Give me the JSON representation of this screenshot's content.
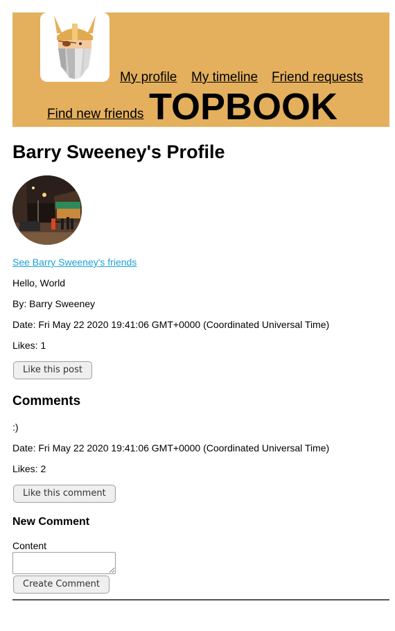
{
  "header": {
    "nav": {
      "my_profile": "My profile",
      "my_timeline": "My timeline",
      "friend_requests": "Friend requests",
      "find_new_friends": "Find new friends"
    },
    "brand": "TOPBOOK",
    "logo_icon": "viking-helmet-logo-icon",
    "background_color": "#e4b05e"
  },
  "profile": {
    "title": "Barry Sweeney's Profile",
    "avatar_icon": "night-street-photo-avatar",
    "friends_link": "See Barry Sweeney's friends"
  },
  "post": {
    "content": "Hello, World",
    "author": "By: Barry Sweeney",
    "date": "Date: Fri May 22 2020 19:41:06 GMT+0000 (Coordinated Universal Time)",
    "likes": "Likes: 1",
    "like_button": "Like this post"
  },
  "comments": {
    "heading": "Comments",
    "items": [
      {
        "content": ":)",
        "date": "Date: Fri May 22 2020 19:41:06 GMT+0000 (Coordinated Universal Time)",
        "likes": "Likes: 2",
        "like_button": "Like this comment"
      }
    ]
  },
  "new_comment": {
    "heading": "New Comment",
    "content_label": "Content",
    "content_value": "",
    "submit_button": "Create Comment"
  },
  "colors": {
    "link": "#1aa0d8",
    "header": "#e4b05e"
  }
}
